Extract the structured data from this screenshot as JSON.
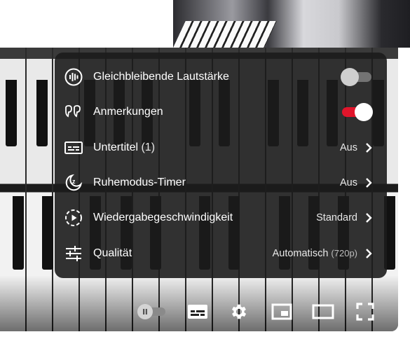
{
  "settings_menu": {
    "items": [
      {
        "label": "Gleichbleibende Lautstärke",
        "extra": "",
        "control": "toggle",
        "state": "off",
        "icon": "stable-volume-icon"
      },
      {
        "label": "Anmerkungen",
        "extra": "",
        "control": "toggle",
        "state": "on",
        "icon": "annotations-icon"
      },
      {
        "label": "Untertitel",
        "extra": " (1)",
        "value": "Aus",
        "value_sub": "",
        "icon": "subtitles-icon"
      },
      {
        "label": "Ruhemodus-Timer",
        "extra": "",
        "value": "Aus",
        "value_sub": "",
        "icon": "sleep-timer-icon"
      },
      {
        "label": "Wiedergabegeschwindigkeit",
        "extra": "",
        "value": "Standard",
        "value_sub": "",
        "icon": "playback-speed-icon"
      },
      {
        "label": "Qualität",
        "extra": "",
        "value": "Automatisch ",
        "value_sub": "(720p)",
        "icon": "quality-sliders-icon"
      }
    ]
  },
  "controls": {
    "autoplay": "off",
    "icons": [
      "autoplay-toggle-icon",
      "subtitles-icon",
      "settings-gear-icon",
      "miniplayer-icon",
      "theater-mode-icon",
      "fullscreen-icon"
    ]
  },
  "colors": {
    "toggle_on": "#e0152b",
    "menu_bg": "#1c1c1c"
  }
}
